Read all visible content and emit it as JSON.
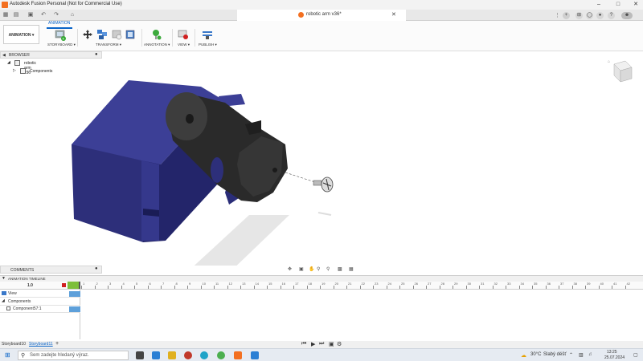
{
  "window": {
    "title": "Autodesk Fusion Personal (Not for Commercial Use)",
    "doc_tab": "robotic arm v36*"
  },
  "toolbar": {
    "workspace": "ANIMATION",
    "tab": "ANIMATION",
    "groups": [
      "STORYBOARD",
      "TRANSFORM",
      "ANNOTATION",
      "VIEW",
      "PUBLISH"
    ]
  },
  "browser": {
    "header": "BROWSER",
    "root": "robotic arm v36",
    "items": [
      "Components"
    ]
  },
  "comments": {
    "label": "COMMENTS"
  },
  "timeline": {
    "header": "ANIMATION TIMELINE",
    "time_value": "1.0",
    "rows": [
      "View",
      "Components",
      "Component57:1"
    ],
    "ticks": [
      "1",
      "2",
      "3",
      "4",
      "5",
      "6",
      "7",
      "8",
      "9",
      "10",
      "11",
      "12",
      "13",
      "14",
      "15",
      "16",
      "17",
      "18",
      "19",
      "20",
      "21",
      "22",
      "23",
      "24",
      "25",
      "26",
      "27",
      "28",
      "29",
      "30",
      "31",
      "32",
      "33",
      "34",
      "35",
      "36",
      "37",
      "38",
      "39",
      "40",
      "41",
      "42"
    ]
  },
  "storyboards": [
    "Storyboard10",
    "Storyboard11"
  ],
  "taskbar": {
    "search_placeholder": "Sem zadejte hledaný výraz.",
    "weather_temp": "30°C",
    "weather_text": "Slabý déšť",
    "time": "13:25",
    "date": "25.07.2024"
  },
  "colors": {
    "accent": "#0a64c8",
    "servo_body": "#2d2f7a",
    "arm": "#2b2b2b",
    "brand": "#f37021"
  }
}
